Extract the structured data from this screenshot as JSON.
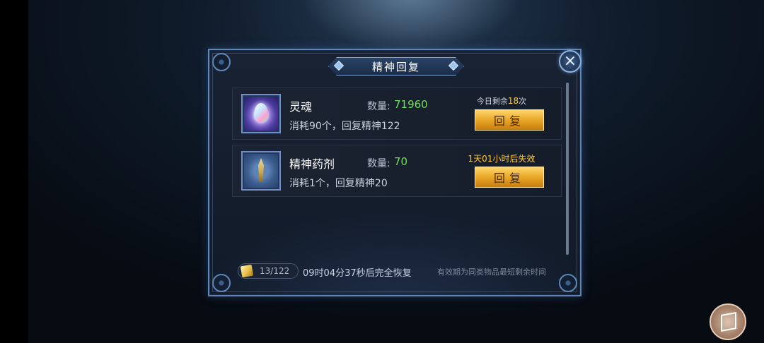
{
  "dialog": {
    "title": "精神回复",
    "close_icon": "×"
  },
  "items": [
    {
      "name": "灵魂",
      "icon": "soul-gem-icon",
      "qty_label": "数量:",
      "qty_value": "71960",
      "desc": "消耗90个，回复精神122",
      "note_prefix": "今日剩余",
      "note_highlight": "18",
      "note_suffix": "次",
      "button_label": "回复"
    },
    {
      "name": "精神药剂",
      "icon": "spirit-potion-icon",
      "qty_label": "数量:",
      "qty_value": "70",
      "desc": "消耗1个，回复精神20",
      "note": "1天01小时后失效",
      "button_label": "回复"
    }
  ],
  "footer": {
    "count": "13/122",
    "timer_text": "09时04分37秒后完全恢复",
    "hint": "有效期为同类物品最短剩余时间"
  },
  "colors": {
    "quantity": "#6fe05a",
    "highlight": "#ffcc33",
    "button": "#e6a323"
  }
}
